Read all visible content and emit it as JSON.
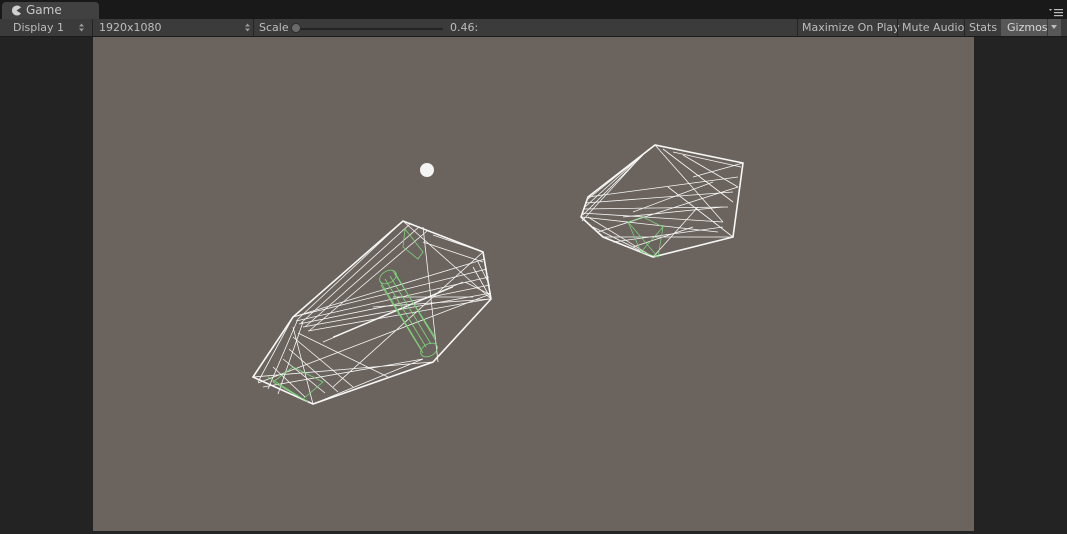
{
  "tab": {
    "title": "Game",
    "icon": "pacman-icon"
  },
  "toolbar": {
    "display": "Display 1",
    "resolution": "1920x1080",
    "scale_label": "Scale",
    "scale_value": "0.46:",
    "maximize": "Maximize On Play",
    "mute": "Mute Audio",
    "stats": "Stats",
    "gizmos": "Gizmos"
  },
  "colors": {
    "viewport_bg": "#6b645e",
    "wire_white": "#ffffff",
    "wire_green": "#7dd67a"
  }
}
